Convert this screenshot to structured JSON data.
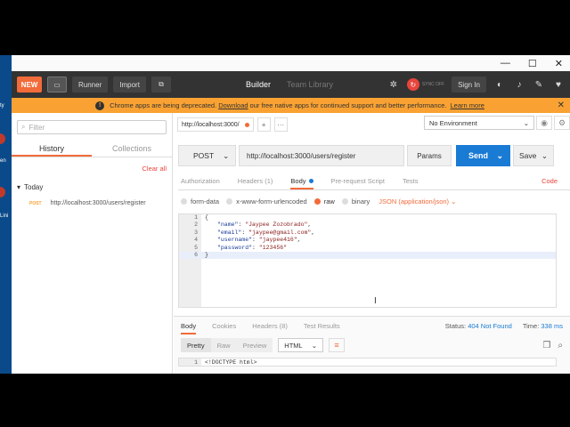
{
  "desktop": {
    "labels": [
      "ty",
      "en",
      "Lini"
    ]
  },
  "window_controls": {
    "minimize": "—",
    "maximize": "☐",
    "close": "✕"
  },
  "toolbar": {
    "new_label": "NEW",
    "runner_label": "Runner",
    "import_label": "Import",
    "builder_label": "Builder",
    "team_library_label": "Team Library",
    "sync_label": "SYNC OFF",
    "sign_in_label": "Sign In"
  },
  "banner": {
    "text_before": "Chrome apps are being deprecated.",
    "link1": "Download",
    "text_middle": "our free native apps for continued support and better performance.",
    "link2": "Learn more"
  },
  "sidebar": {
    "filter_placeholder": "Filter",
    "tabs": [
      {
        "label": "History"
      },
      {
        "label": "Collections"
      }
    ],
    "clear_all": "Clear all",
    "group_label": "Today",
    "items": [
      {
        "method": "POST",
        "url": "http://localhost:3000/users/register"
      }
    ]
  },
  "request_tabs": [
    {
      "label": "http://localhost:3000/"
    }
  ],
  "environment": {
    "selected": "No Environment"
  },
  "request": {
    "method": "POST",
    "url": "http://localhost:3000/users/register",
    "params_label": "Params",
    "send_label": "Send",
    "save_label": "Save"
  },
  "subtabs": {
    "authorization": "Authorization",
    "headers": "Headers (1)",
    "body": "Body",
    "prerequest": "Pre-request Script",
    "tests": "Tests",
    "code": "Code"
  },
  "body_types": {
    "form_data": "form-data",
    "urlencoded": "x-www-form-urlencoded",
    "raw": "raw",
    "binary": "binary",
    "content_type": "JSON (application/json)"
  },
  "editor": {
    "lines": [
      {
        "num": "1",
        "text": "{"
      },
      {
        "num": "2",
        "key": "\"name\"",
        "value": "\"Jaypee Zozobrado\"",
        "comma": ","
      },
      {
        "num": "3",
        "key": "\"email\"",
        "value": "\"jaypee@gmail.com\"",
        "comma": ","
      },
      {
        "num": "4",
        "key": "\"username\"",
        "value": "\"jaypee416\"",
        "comma": ","
      },
      {
        "num": "5",
        "key": "\"password\"",
        "value": "\"123456\"",
        "comma": ""
      },
      {
        "num": "6",
        "text": "}"
      }
    ]
  },
  "response": {
    "tabs": {
      "body": "Body",
      "cookies": "Cookies",
      "headers": "Headers (8)",
      "tests": "Test Results"
    },
    "status_label": "Status:",
    "status_value": "404 Not Found",
    "time_label": "Time:",
    "time_value": "338 ms",
    "view_modes": {
      "pretty": "Pretty",
      "raw": "Raw",
      "preview": "Preview"
    },
    "format": "HTML",
    "code_line": {
      "num": "1",
      "text": "<!DOCTYPE html>"
    }
  }
}
